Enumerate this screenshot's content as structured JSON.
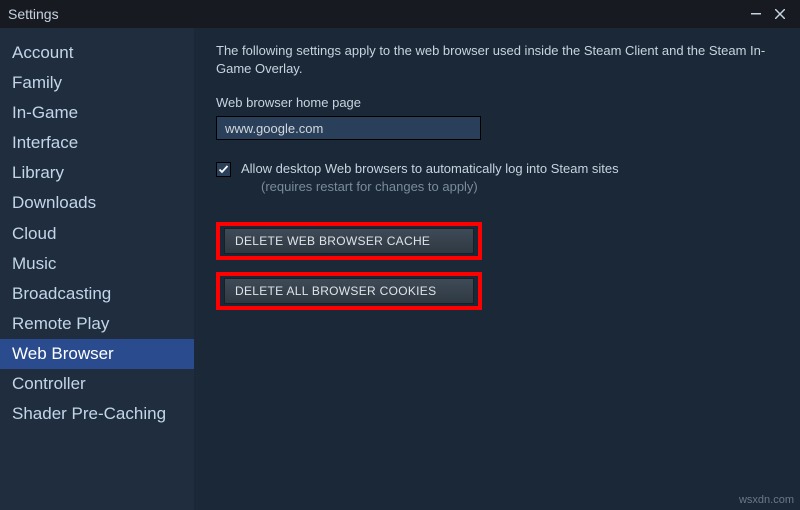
{
  "window": {
    "title": "Settings"
  },
  "sidebar": {
    "items": [
      {
        "label": "Account",
        "selected": false
      },
      {
        "label": "Family",
        "selected": false
      },
      {
        "label": "In-Game",
        "selected": false
      },
      {
        "label": "Interface",
        "selected": false
      },
      {
        "label": "Library",
        "selected": false
      },
      {
        "label": "Downloads",
        "selected": false
      },
      {
        "label": "Cloud",
        "selected": false
      },
      {
        "label": "Music",
        "selected": false
      },
      {
        "label": "Broadcasting",
        "selected": false
      },
      {
        "label": "Remote Play",
        "selected": false
      },
      {
        "label": "Web Browser",
        "selected": true
      },
      {
        "label": "Controller",
        "selected": false
      },
      {
        "label": "Shader Pre-Caching",
        "selected": false
      }
    ]
  },
  "main": {
    "description": "The following settings apply to the web browser used inside the Steam Client and the Steam In-Game Overlay.",
    "homepage_label": "Web browser home page",
    "homepage_value": "www.google.com",
    "autologin_checked": true,
    "autologin_label": "Allow desktop Web browsers to automatically log into Steam sites",
    "autologin_sub": "(requires restart for changes to apply)",
    "delete_cache_label": "DELETE WEB BROWSER CACHE",
    "delete_cookies_label": "DELETE ALL BROWSER COOKIES"
  },
  "watermark": "wsxdn.com"
}
